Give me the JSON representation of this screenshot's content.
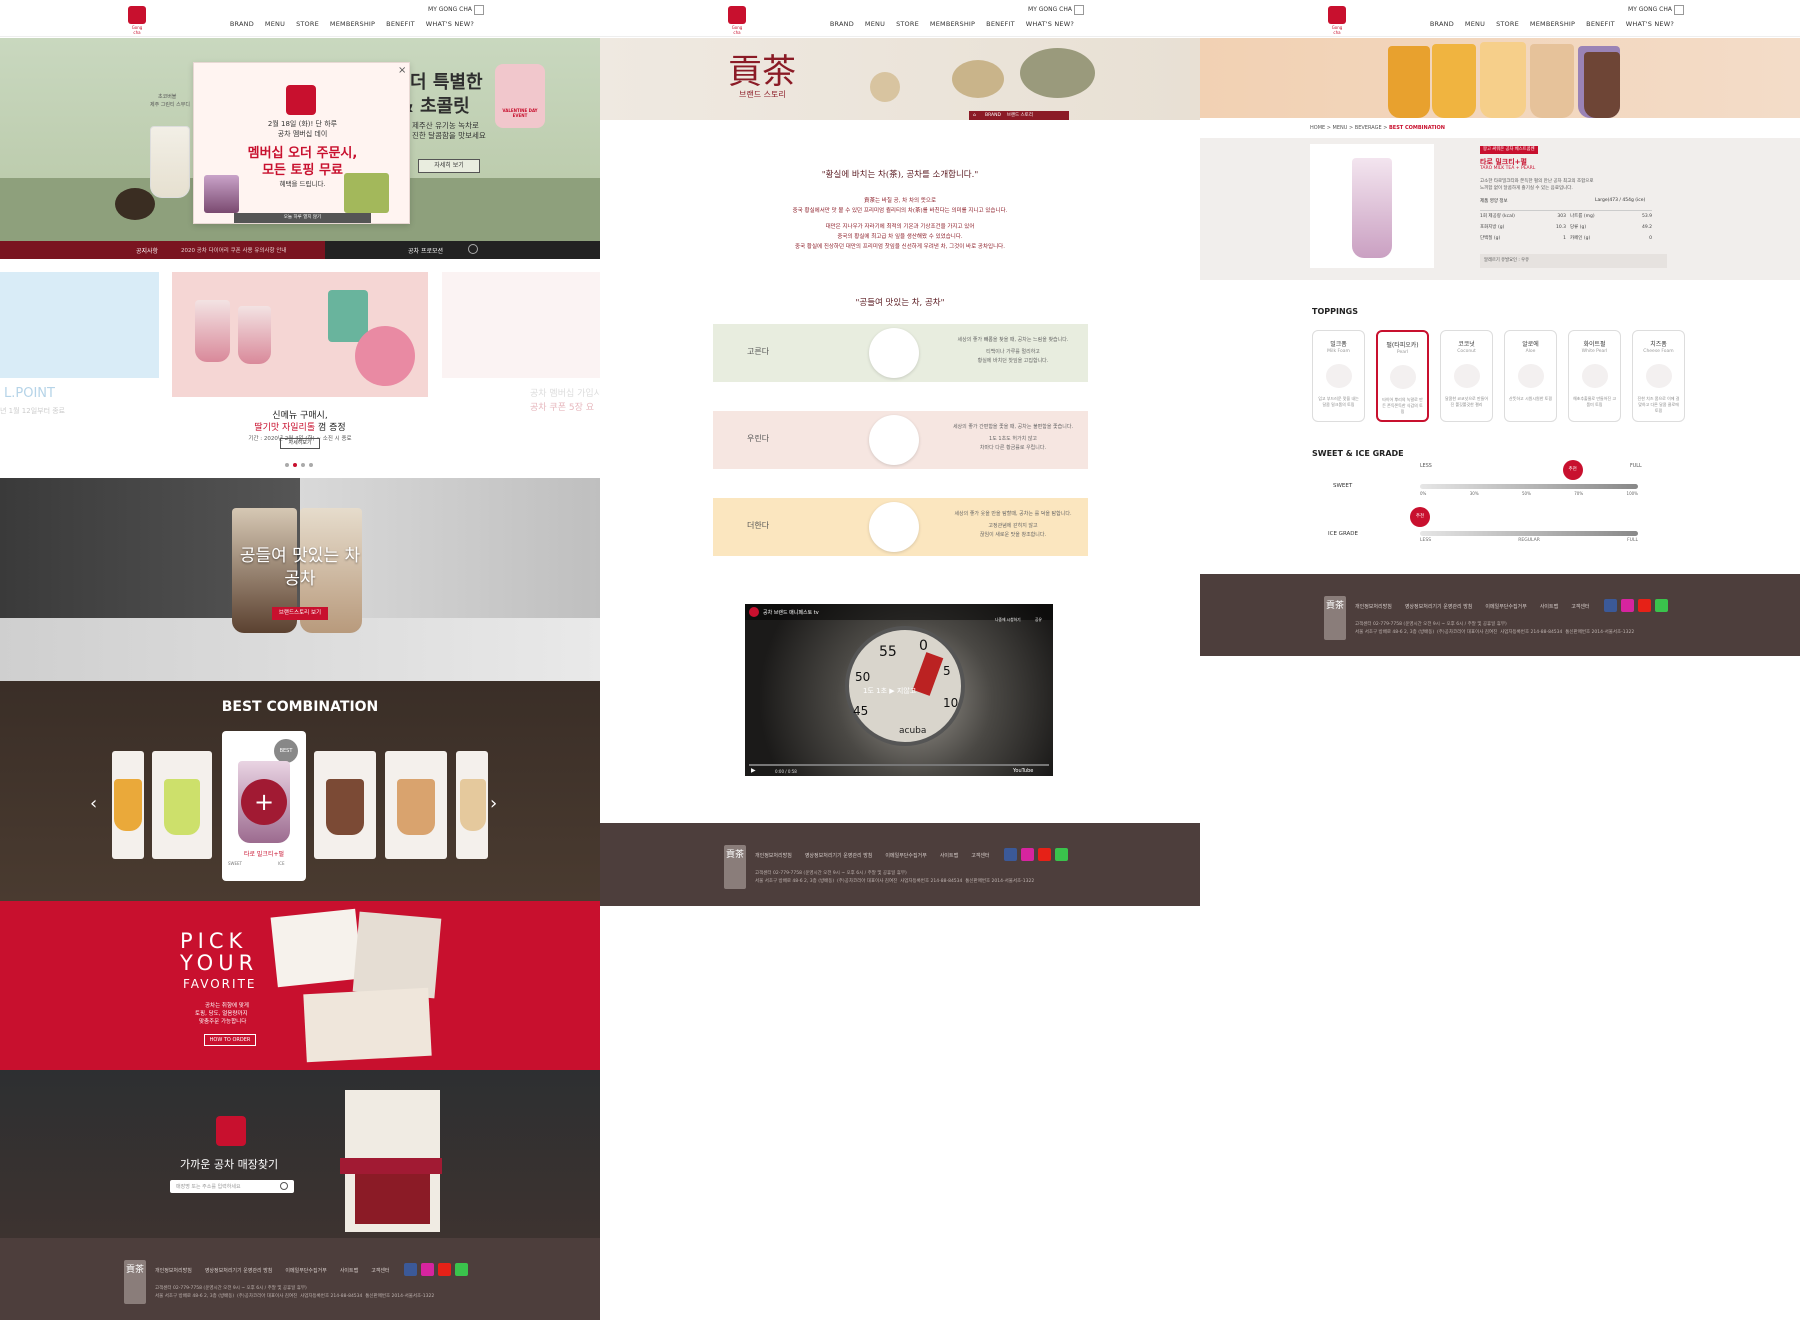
{
  "nav": {
    "my_gong_cha": "MY GONG CHA",
    "items": [
      "BRAND",
      "MENU",
      "STORE",
      "MEMBERSHIP",
      "BENEFIT",
      "WHAT'S NEW?"
    ],
    "logo_text": "Gong cha"
  },
  "home": {
    "hero": {
      "title_line1": "더 특별한",
      "title_line2": "& 초콜릿",
      "desc_line1": "제주산 유기농 녹차로",
      "desc_line2": "진한 달콤함을 맛보세요",
      "more": "자세히 보기",
      "product_label1": "초코버블",
      "product_label2": "제주 그린티 스무디",
      "badge": "VALENTINE DAY EVENT"
    },
    "popup": {
      "line1": "2월 18일 (화)! 단 하루",
      "line2": "공차 멤버십 데이",
      "headline1": "멤버십 오더 주문시,",
      "headline2": "모든 토핑 무료",
      "sub": "혜택을 드립니다.",
      "no_show": "오늘 하루 열지 않기"
    },
    "notice_bar": {
      "label": "공지사항",
      "text": "2020 공차 다이어리 쿠폰 사용 유의사항 안내",
      "promo": "공차 프로모션"
    },
    "promo": {
      "left_text": "L.POINT",
      "left_date": "년 1월 12일부터 종료",
      "center_line1": "신메뉴 구매시,",
      "center_hl": "딸기맛 자일리톨",
      "center_after": " 껌 증정",
      "center_period": "기간 : 2020년 2월 4일 (화) ~ 소진 시 종료",
      "center_btn": "자세히보기",
      "right_line1": "공차 멤버십 가입시",
      "right_line2": "공차 쿠폰 5장 요",
      "right_period": "기간 : 2020년 1월 15일(수) ~ 2020"
    },
    "brand": {
      "line1": "공들여 맛있는 차",
      "line2": "공차",
      "btn": "브랜드스토리 보기"
    },
    "best": {
      "title": "BEST COMBINATION",
      "badge": "BEST",
      "name": "타로 밀크티+펄",
      "sweet": "SWEET",
      "ice": "ICE"
    },
    "pick": {
      "l1": "PICK",
      "l2": "YOUR",
      "l3": "FAVORITE",
      "desc1": "공차는 취향에 맞게",
      "desc2": "토핑, 당도, 얼음량까지",
      "desc3": "맞춤주문 가능합니다",
      "btn": "HOW TO ORDER"
    },
    "store": {
      "title": "가까운 공차 매장찾기",
      "placeholder": "매장명 또는 주소를 입력하세요"
    }
  },
  "footer": {
    "links": [
      "개인정보처리방침",
      "영상정보처리기기 운영관리 방침",
      "이메일무단수집거부",
      "사이트맵",
      "고객센터"
    ],
    "info1": "고객센터 02-779-7758 (운영시간 오전 9시 ~ 오후 6시 / 주말 및 공휴일 휴무)",
    "info2": "서울 서초구 방배로 48-6 2, 3층 (방배동)",
    "info3": "(주)공차코리아 대표이사 김여진",
    "info4": "사업자등록번호 214-88-84534",
    "info5": "통신판매번호 2014-서울서초-1322",
    "logo": "貢茶"
  },
  "brand_page": {
    "logo_chars": "貢茶",
    "subtitle": "브랜드 스토리",
    "crumb": [
      "BRAND",
      "브랜드 스토리"
    ],
    "quote1": "\"황실에 바치는 차(茶), 공차를 소개합니다.\"",
    "p1": "貢茶는 바칠 공, 차 차의 뜻으로",
    "p2": "중국 황실에서만 맛 볼 수 있던 프리미엄 퀄리티의 차(茶)를 바친다는 의미를 지니고 있습니다.",
    "p3": "대만은 지나우가 자라기에 최적의 기온과 기상조건을 가지고 있어",
    "p4": "중국의 황실에 최고급 차 잎을 생산해왔 수 있었습니다.",
    "p5": "중국 황실에 진상하던 대만의 프리미엄 찻잎을 신선하게 우려낸 차, 그것이 바로 공차입니다.",
    "quote2": "\"공들여 맛있는 차, 공차\"",
    "rows": [
      {
        "label": "고른다",
        "t1": "세상의 좋가 빼롭을 찾을 때, 공차는 느림을 찾습니다.",
        "t2": "티백이나 가루를 멀리하고",
        "t3": "황실에 바치던 찻잎을 고집합니다."
      },
      {
        "label": "우린다",
        "t1": "세상의 좋가 간편함을 좇을 때, 공차는 불편함을 좇습니다.",
        "t2": "1도 1초도 허가치 않고",
        "t3": "차마다 다른 황금률로 우립니다."
      },
      {
        "label": "더한다",
        "t1": "세상의 좋가 웃을 만을 탐할때, 공차는 를 덕을 탐합니다.",
        "t2": "고정관념에 갇히지 않고",
        "t3": "끊임이 새로운 맛을 창조합니다."
      }
    ],
    "video": {
      "title": "공차 브랜드 매니페스토 tv",
      "watch_later": "나중에 시청하기",
      "share": "공유",
      "caption": "1도 1초 ▶ 지않고",
      "brand": "acuba",
      "time": "0:00 / 0:58",
      "youtube": "YouTube",
      "dial": [
        "55",
        "0",
        "5",
        "10",
        "50",
        "45",
        "15"
      ]
    }
  },
  "menu_page": {
    "breadcrumb": [
      "HOME",
      "MENU",
      "BEVERAGE",
      "BEST COMBINATION"
    ],
    "tag": "왕고 싸워온 공차 베스트콤벤",
    "name": "타로 밀크티+펄",
    "name_en": "TARO MILK TEA + PEARL",
    "desc1": "고소한 타로밀크티와 쫀득한 펄의 만난 공차 최고의 조합으로",
    "desc2": "느끼함 없이 달콤하게 즐기실 수 있는 음료입니다.",
    "nutri_title": "제품 영양 정보",
    "nutri_size": "Large(473 / 454g (ice)",
    "nutrition": [
      {
        "k": "1회 제공량 (kcal)",
        "v": "303",
        "k2": "나트륨 (mg)",
        "v2": "53.9"
      },
      {
        "k": "포화지방 (g)",
        "v": "10.3",
        "k2": "당류 (g)",
        "v2": "49.2"
      },
      {
        "k": "단백질 (g)",
        "v": "1",
        "k2": "카페인 (g)",
        "v2": "0"
      }
    ],
    "allergy": "알레르기 유발요인 : 우유",
    "toppings_title": "TOPPINGS",
    "toppings": [
      {
        "name": "밀크폼",
        "en": "Milk Foam",
        "desc": "입고 부드러운 맛을 내는 달콤 밀크폼의 토핑"
      },
      {
        "name": "펄(타피오카)",
        "en": "Pearl",
        "desc": "타이어 뿌리의 녹말로 만든 쫀득쫀득한 식감의 토핑"
      },
      {
        "name": "코코넛",
        "en": "Coconut",
        "desc": "달콤한 코코넛으로 만들어진 쫄깃쫄깃한 젤리"
      },
      {
        "name": "알로에",
        "en": "Aloe",
        "desc": "산뜻하고 시원시원한 토핑"
      },
      {
        "name": "화이트펄",
        "en": "White Pearl",
        "desc": "해초추출물로 만들어진 고품미 토핑"
      },
      {
        "name": "치즈폼",
        "en": "Cheese Foam",
        "desc": "진한 치즈 폼으로 이에 걸맞하고 다른 달콤 클로에 토핑"
      }
    ],
    "grade_title": "SWEET & ICE GRADE",
    "sweet_label": "SWEET",
    "ice_label": "ICE GRADE",
    "less": "LESS",
    "full": "FULL",
    "recommend": "추천",
    "sweet_ticks": [
      "0%",
      "30%",
      "50%",
      "70%",
      "100%"
    ],
    "sweet_level": 0.7,
    "ice_ticks": [
      "LESS",
      "REGULAR",
      "FULL"
    ],
    "ice_level": 0.0
  },
  "colors": {
    "brand_red": "#c8102e",
    "footer_brown": "#4d3e3c",
    "dark_bar": "#222222"
  }
}
